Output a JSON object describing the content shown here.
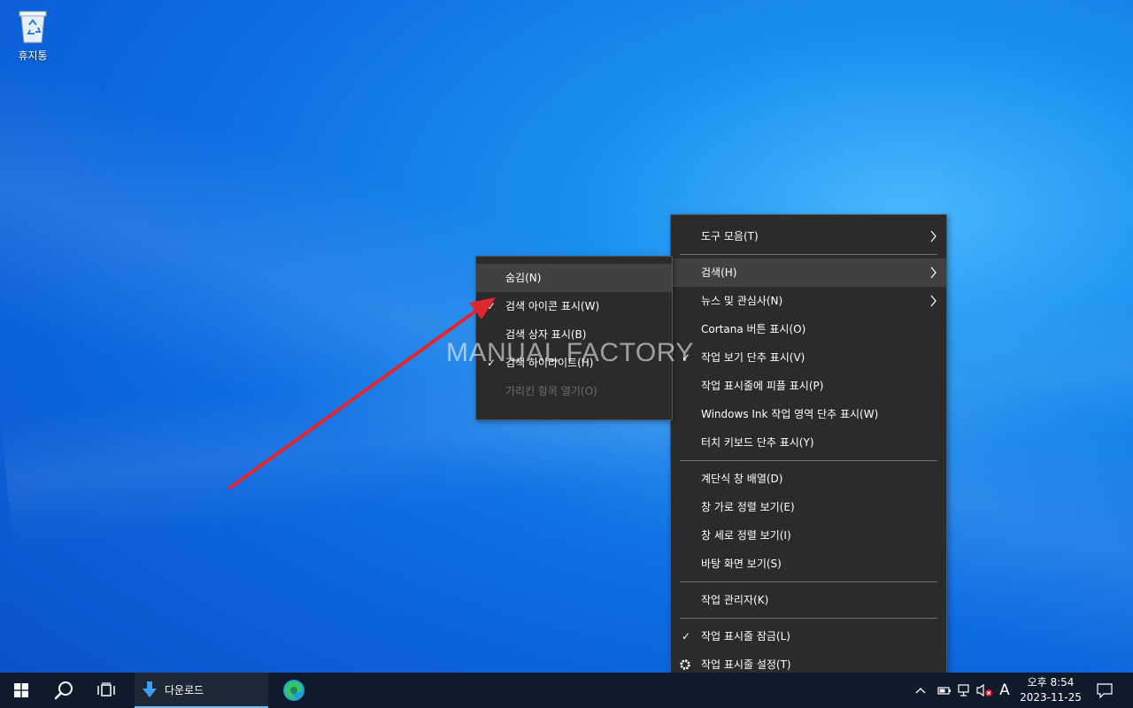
{
  "desktop": {
    "recycle_bin_label": "휴지통",
    "watermark": "MANUAL FACTORY"
  },
  "context_menu": {
    "items": [
      {
        "label": "도구 모음(T)",
        "submenu": true
      },
      {
        "label": "검색(H)",
        "submenu": true,
        "highlighted": true
      },
      {
        "label": "뉴스 및 관심사(N)",
        "submenu": true
      },
      {
        "label": "Cortana 버튼 표시(O)"
      },
      {
        "label": "작업 보기 단추 표시(V)",
        "checked": true
      },
      {
        "label": "작업 표시줄에 피플 표시(P)"
      },
      {
        "label": "Windows Ink 작업 영역 단추 표시(W)"
      },
      {
        "label": "터치 키보드 단추 표시(Y)"
      },
      {
        "label": "계단식 창 배열(D)"
      },
      {
        "label": "창 가로 정렬 보기(E)"
      },
      {
        "label": "창 세로 정렬 보기(I)"
      },
      {
        "label": "바탕 화면 보기(S)"
      },
      {
        "label": "작업 관리자(K)"
      },
      {
        "label": "작업 표시줄 잠금(L)",
        "checked": true
      },
      {
        "label": "작업 표시줄 설정(T)",
        "icon": "gear-icon"
      }
    ]
  },
  "search_submenu": {
    "items": [
      {
        "label": "숨김(N)",
        "highlighted": true
      },
      {
        "label": "검색 아이콘 표시(W)",
        "checked": true
      },
      {
        "label": "검색 상자 표시(B)"
      },
      {
        "label": "검색 하이라이트(H)",
        "checked": true
      },
      {
        "label": "가리킨 항목 열기(O)",
        "disabled": true
      }
    ]
  },
  "taskbar": {
    "downloads_label": "다운로드",
    "ime_indicator": "A",
    "clock_time": "오후 8:54",
    "clock_date": "2023-11-25"
  },
  "glyphs": {
    "check": "✓",
    "arrow": "›",
    "gear": "⚙"
  },
  "colors": {
    "menu_bg": "#2b2b2b",
    "menu_highlight": "#414141",
    "taskbar_bg": "#0f1a2a",
    "annotation_arrow": "#e0262f"
  }
}
